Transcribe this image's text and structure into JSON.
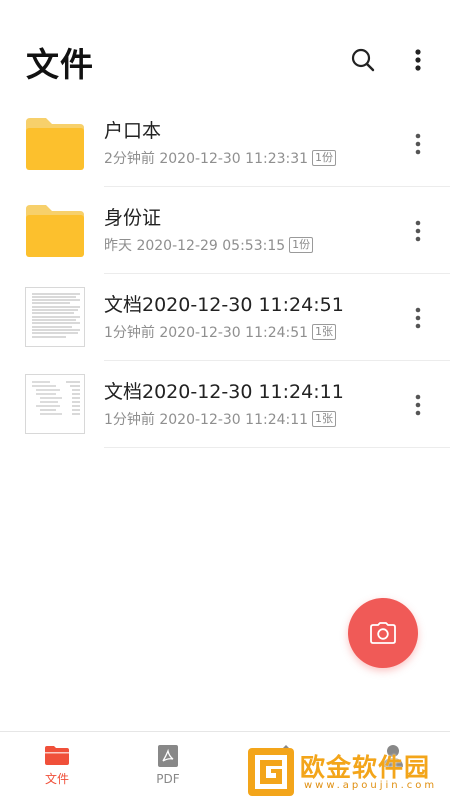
{
  "header": {
    "title": "文件",
    "search_icon": "search-icon",
    "more_icon": "more-vertical-icon"
  },
  "files": [
    {
      "type": "folder",
      "name": "户口本",
      "time": "2分钟前 2020-12-30 11:23:31",
      "badge": "1份"
    },
    {
      "type": "folder",
      "name": "身份证",
      "time": "昨天 2020-12-29 05:53:15",
      "badge": "1份"
    },
    {
      "type": "document",
      "name": "文档2020-12-30 11:24:51",
      "time": "1分钟前 2020-12-30 11:24:51",
      "badge": "1张"
    },
    {
      "type": "document",
      "name": "文档2020-12-30 11:24:11",
      "time": "1分钟前 2020-12-30 11:24:11",
      "badge": "1张"
    }
  ],
  "fab": {
    "icon": "camera-icon"
  },
  "nav": {
    "items": [
      {
        "label": "文件",
        "icon": "folder-icon",
        "active": true
      },
      {
        "label": "PDF",
        "icon": "pdf-icon",
        "active": false
      },
      {
        "label": "",
        "icon": "tools-icon",
        "active": false
      },
      {
        "label": "",
        "icon": "user-icon",
        "active": false
      }
    ]
  },
  "watermark": {
    "text": "欧金软件园",
    "url": "www.apoujin.com"
  },
  "colors": {
    "accent": "#f05a57",
    "folder": "#fcc02d",
    "nav_active": "#f0503a",
    "watermark": "#f3a51a"
  }
}
